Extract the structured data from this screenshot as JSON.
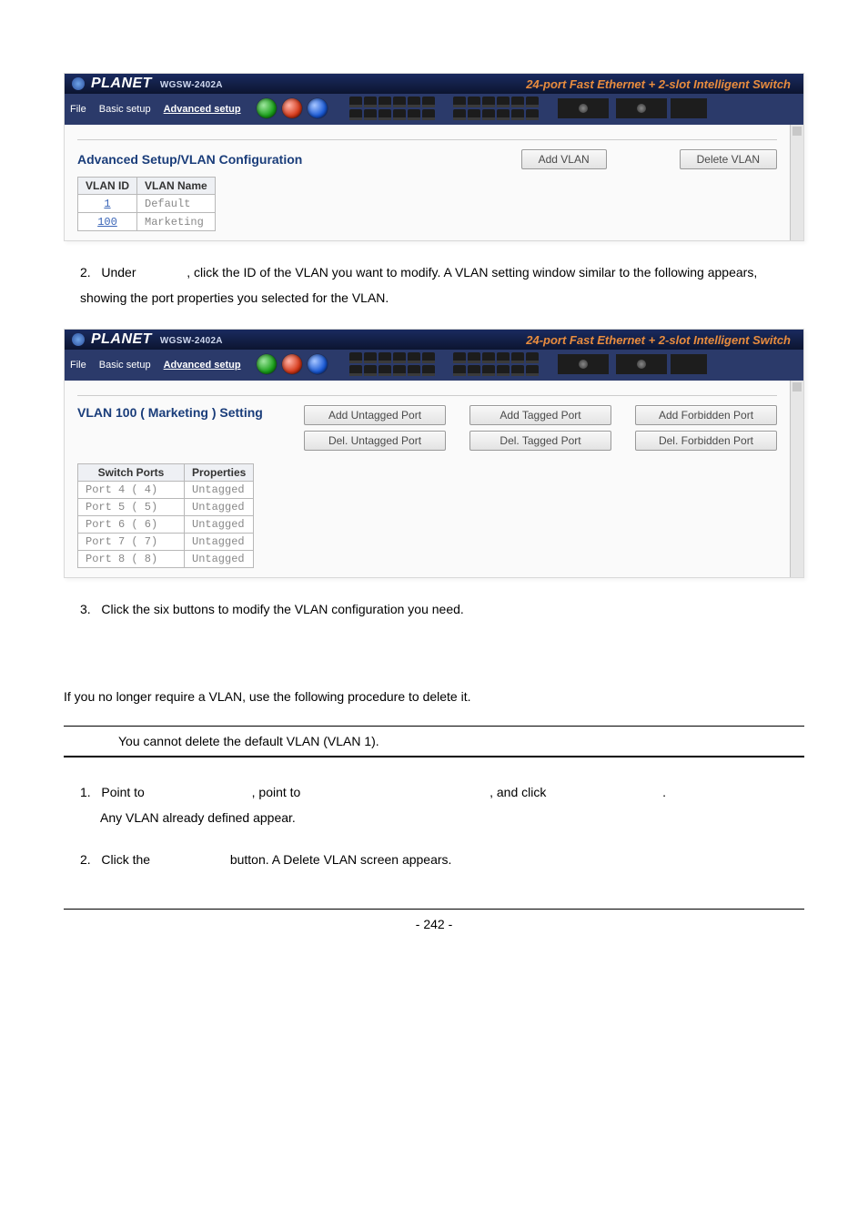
{
  "brand": {
    "name": "PLANET",
    "model": "WGSW-2402A",
    "tagline": "24-port Fast Ethernet + 2-slot Intelligent Switch"
  },
  "nav": {
    "file": "File",
    "basic": "Basic setup",
    "advanced": "Advanced setup"
  },
  "fig1": {
    "title": "Advanced Setup/VLAN Configuration",
    "btn_add": "Add VLAN",
    "btn_delete": "Delete VLAN",
    "table_head_id": "VLAN ID",
    "table_head_name": "VLAN Name",
    "rows": [
      {
        "id": "1",
        "name": "Default"
      },
      {
        "id": "100",
        "name": "Marketing"
      }
    ]
  },
  "para1_num": "2.",
  "para1_a": "Under ",
  "para1_b": ", click the ID of the VLAN you want to modify. A VLAN setting window similar to the following appears, showing the port properties you selected for the VLAN.",
  "fig2": {
    "title": "VLAN 100 ( Marketing ) Setting",
    "btns": {
      "add_untagged": "Add Untagged Port",
      "add_tagged": "Add Tagged Port",
      "add_forbidden": "Add Forbidden Port",
      "del_untagged": "Del. Untagged Port",
      "del_tagged": "Del. Tagged Port",
      "del_forbidden": "Del. Forbidden Port"
    },
    "table_head_ports": "Switch Ports",
    "table_head_props": "Properties",
    "rows": [
      {
        "port": "Port 4 ( 4)",
        "prop": "Untagged"
      },
      {
        "port": "Port 5 ( 5)",
        "prop": "Untagged"
      },
      {
        "port": "Port 6 ( 6)",
        "prop": "Untagged"
      },
      {
        "port": "Port 7 ( 7)",
        "prop": "Untagged"
      },
      {
        "port": "Port 8 ( 8)",
        "prop": "Untagged"
      }
    ]
  },
  "para2_num": "3.",
  "para2": "Click the six buttons to modify the VLAN configuration you need.",
  "para3": "If you no longer require a VLAN, use the following procedure to delete it.",
  "note": "You cannot delete the default VLAN (VLAN 1).",
  "steps2": {
    "s1_num": "1.",
    "s1_a": "Point to ",
    "s1_b": ", point to ",
    "s1_c": ", and click ",
    "s1_d": ".",
    "s1_sub": "Any VLAN already defined appear.",
    "s2_num": "2.",
    "s2_a": "Click the ",
    "s2_b": " button. A Delete VLAN screen appears."
  },
  "page_number": "- 242 -"
}
